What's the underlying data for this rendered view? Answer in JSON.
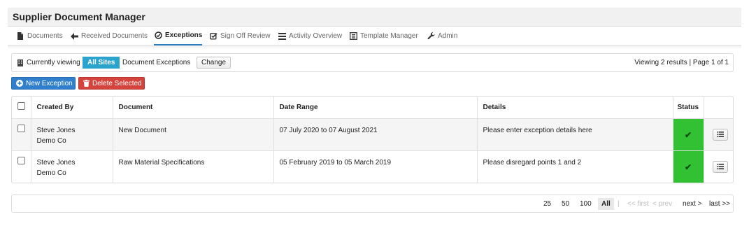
{
  "app": {
    "title": "Supplier Document Manager"
  },
  "nav": [
    {
      "label": "Documents",
      "icon": "document-icon"
    },
    {
      "label": "Received Documents",
      "icon": "arrow-left-icon"
    },
    {
      "label": "Exceptions",
      "icon": "circle-check-icon",
      "active": true
    },
    {
      "label": "Sign Off Review",
      "icon": "checkbox-edit-icon"
    },
    {
      "label": "Activity Overview",
      "icon": "list-icon"
    },
    {
      "label": "Template Manager",
      "icon": "template-icon"
    },
    {
      "label": "Admin",
      "icon": "wrench-icon"
    }
  ],
  "viewbar": {
    "currently_viewing": "Currently viewing",
    "site": "All Sites",
    "context": "Document Exceptions",
    "change_label": "Change",
    "results": "Viewing 2 results | Page 1 of 1"
  },
  "actions": {
    "new_label": "New Exception",
    "delete_label": "Delete Selected"
  },
  "table": {
    "columns": [
      "Created By",
      "Document",
      "Date Range",
      "Details",
      "Status"
    ],
    "rows": [
      {
        "created_by": "Steve Jones",
        "company": "Demo Co",
        "document": "New Document",
        "date_range": "07 July 2020 to 07 August 2021",
        "details": "Please enter exception details here",
        "status_icon": "check-icon",
        "status_color": "#32c132"
      },
      {
        "created_by": "Steve Jones",
        "company": "Demo Co",
        "document": "Raw Material Specifications",
        "date_range": "05 February 2019 to 05 March 2019",
        "details": "Please disregard points 1 and 2",
        "status_icon": "check-icon",
        "status_color": "#32c132"
      }
    ]
  },
  "pager": {
    "sizes": [
      "25",
      "50",
      "100",
      "All"
    ],
    "selected": "All",
    "separator": "|",
    "first": "<< first",
    "prev": "< prev",
    "next": "next >",
    "last": "last >>"
  },
  "colors": {
    "accent": "#2a7bbf",
    "site_badge": "#2aa3cf",
    "new_button": "#2f7fcc",
    "delete_button": "#d5443c",
    "status_ok": "#32c132"
  }
}
